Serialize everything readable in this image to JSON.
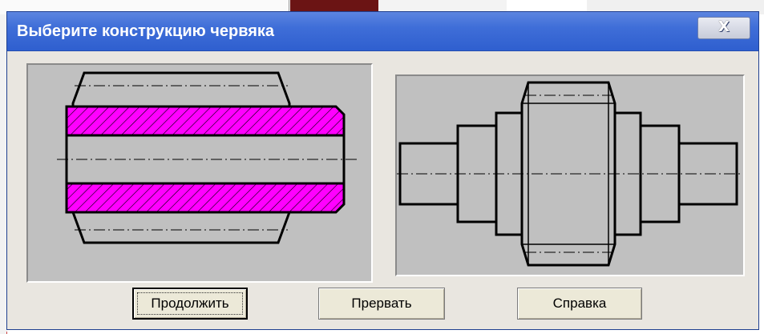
{
  "window": {
    "title": "Выберите конструкцию червяка",
    "close_glyph": "X",
    "close_icon": "close-icon"
  },
  "options": [
    {
      "id": "option-hollow-worm",
      "selected": true
    },
    {
      "id": "option-shaft-worm",
      "selected": false
    }
  ],
  "buttons": {
    "continue_label": "Продолжить",
    "abort_label": "Прервать",
    "help_label": "Справка"
  },
  "colors": {
    "titlebar": "#3f6ed8",
    "hatch_fill": "#ff00ff",
    "panel_bg": "#c0c0c0",
    "dialog_bg": "#e9e6e0"
  }
}
